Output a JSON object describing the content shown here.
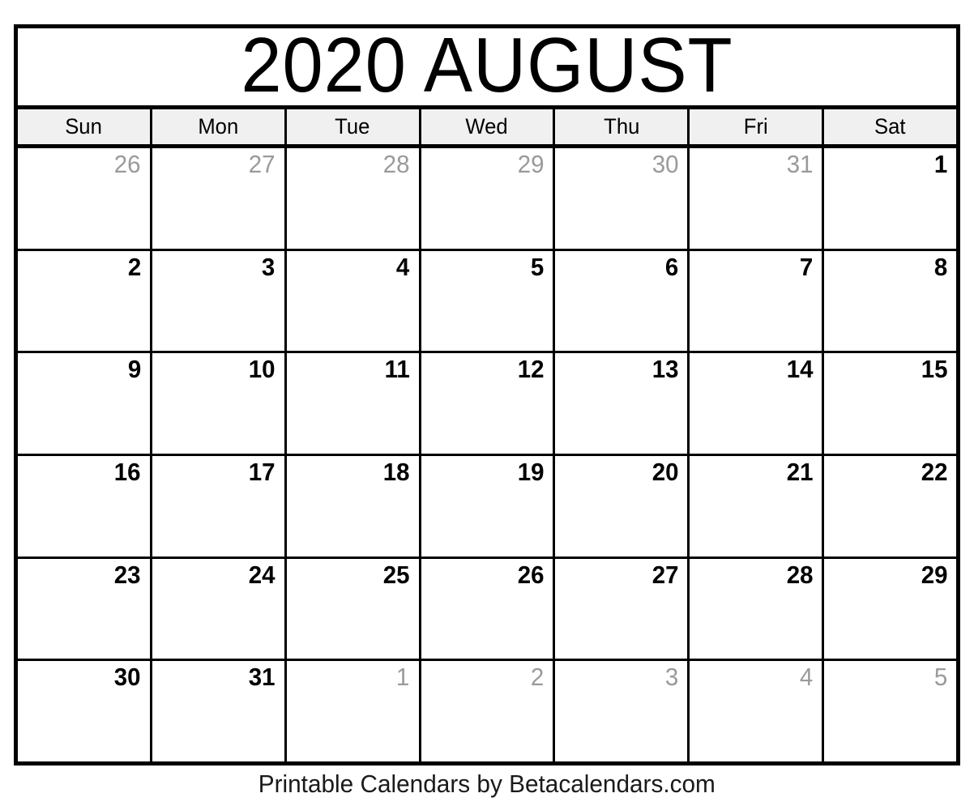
{
  "document": {
    "type": "printable-monthly-calendar",
    "title": "2020 AUGUST",
    "year": "2020",
    "month": "AUGUST"
  },
  "colors": {
    "border": "#000000",
    "header_background": "#f0f0f0",
    "page_background": "#ffffff",
    "current_month_text": "#000000",
    "adjacent_month_text": "#9a9a9a",
    "footer_text": "#1a1a1a"
  },
  "weekdays": [
    {
      "short": "Sun"
    },
    {
      "short": "Mon"
    },
    {
      "short": "Tue"
    },
    {
      "short": "Wed"
    },
    {
      "short": "Thu"
    },
    {
      "short": "Fri"
    },
    {
      "short": "Sat"
    }
  ],
  "weeks": [
    {
      "days": [
        {
          "number": "26",
          "in_month": false
        },
        {
          "number": "27",
          "in_month": false
        },
        {
          "number": "28",
          "in_month": false
        },
        {
          "number": "29",
          "in_month": false
        },
        {
          "number": "30",
          "in_month": false
        },
        {
          "number": "31",
          "in_month": false
        },
        {
          "number": "1",
          "in_month": true
        }
      ]
    },
    {
      "days": [
        {
          "number": "2",
          "in_month": true
        },
        {
          "number": "3",
          "in_month": true
        },
        {
          "number": "4",
          "in_month": true
        },
        {
          "number": "5",
          "in_month": true
        },
        {
          "number": "6",
          "in_month": true
        },
        {
          "number": "7",
          "in_month": true
        },
        {
          "number": "8",
          "in_month": true
        }
      ]
    },
    {
      "days": [
        {
          "number": "9",
          "in_month": true
        },
        {
          "number": "10",
          "in_month": true
        },
        {
          "number": "11",
          "in_month": true
        },
        {
          "number": "12",
          "in_month": true
        },
        {
          "number": "13",
          "in_month": true
        },
        {
          "number": "14",
          "in_month": true
        },
        {
          "number": "15",
          "in_month": true
        }
      ]
    },
    {
      "days": [
        {
          "number": "16",
          "in_month": true
        },
        {
          "number": "17",
          "in_month": true
        },
        {
          "number": "18",
          "in_month": true
        },
        {
          "number": "19",
          "in_month": true
        },
        {
          "number": "20",
          "in_month": true
        },
        {
          "number": "21",
          "in_month": true
        },
        {
          "number": "22",
          "in_month": true
        }
      ]
    },
    {
      "days": [
        {
          "number": "23",
          "in_month": true
        },
        {
          "number": "24",
          "in_month": true
        },
        {
          "number": "25",
          "in_month": true
        },
        {
          "number": "26",
          "in_month": true
        },
        {
          "number": "27",
          "in_month": true
        },
        {
          "number": "28",
          "in_month": true
        },
        {
          "number": "29",
          "in_month": true
        }
      ]
    },
    {
      "days": [
        {
          "number": "30",
          "in_month": true
        },
        {
          "number": "31",
          "in_month": true
        },
        {
          "number": "1",
          "in_month": false
        },
        {
          "number": "2",
          "in_month": false
        },
        {
          "number": "3",
          "in_month": false
        },
        {
          "number": "4",
          "in_month": false
        },
        {
          "number": "5",
          "in_month": false
        }
      ]
    }
  ],
  "footer": {
    "text": "Printable Calendars by Betacalendars.com"
  }
}
